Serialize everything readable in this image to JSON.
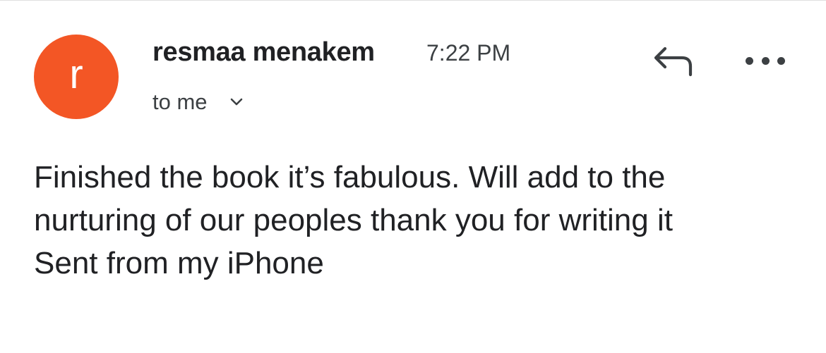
{
  "colors": {
    "avatar_bg": "#F35625",
    "text_primary": "#202124",
    "text_secondary": "#3c4043"
  },
  "message": {
    "avatar_letter": "r",
    "sender_name": "resmaa menakem",
    "time": "7:22 PM",
    "recipient": "to me",
    "body_lines": [
      "Finished the book it’s fabulous. Will add to the",
      "nurturing of our peoples thank you for writing it",
      "Sent from my iPhone"
    ]
  },
  "icons": {
    "reply": "reply-icon",
    "more": "more-options-icon",
    "expand": "chevron-down-icon"
  }
}
